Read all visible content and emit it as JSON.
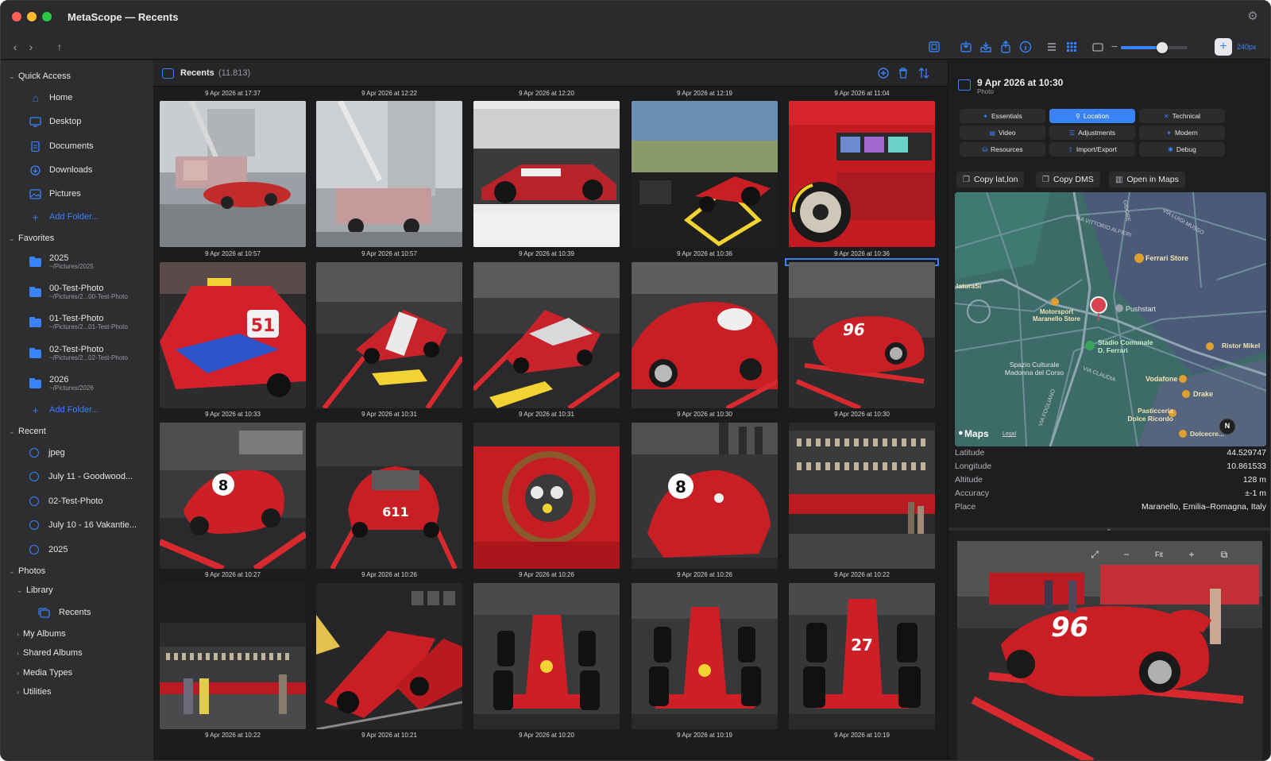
{
  "window": {
    "title": "MetaScope — Recents"
  },
  "toolbar": {
    "back": "‹",
    "forward": "›",
    "up": "↑",
    "minus": "−",
    "plus": "+",
    "thumb_size": "240px",
    "thumb_size_fraction": 0.62,
    "accent": "#3a82f7"
  },
  "sidebar": {
    "quick_access": {
      "label": "Quick Access",
      "items": [
        {
          "label": "Home",
          "icon": "house-icon"
        },
        {
          "label": "Desktop",
          "icon": "desktop-icon"
        },
        {
          "label": "Documents",
          "icon": "document-icon"
        },
        {
          "label": "Downloads",
          "icon": "download-icon"
        },
        {
          "label": "Pictures",
          "icon": "photo-icon"
        }
      ],
      "add": "Add Folder..."
    },
    "favorites": {
      "label": "Favorites",
      "items": [
        {
          "name": "2025",
          "path": "~/Pictures/2025"
        },
        {
          "name": "00-Test-Photo",
          "path": "~/Pictures/2...00-Test-Photo"
        },
        {
          "name": "01-Test-Photo",
          "path": "~/Pictures/2...01-Test-Photo"
        },
        {
          "name": "02-Test-Photo",
          "path": "~/Pictures/2...02-Test-Photo"
        },
        {
          "name": "2026",
          "path": "~/Pictures/2026"
        }
      ],
      "add": "Add Folder..."
    },
    "recent": {
      "label": "Recent",
      "items": [
        "jpeg",
        "July 11 - Goodwood...",
        "02-Test-Photo",
        "July 10 - 16 Vakantie...",
        "2025"
      ]
    },
    "photos": {
      "label": "Photos",
      "library": "Library",
      "recents": "Recents",
      "groups": [
        "My Albums",
        "Shared Albums",
        "Media Types",
        "Utilities"
      ]
    }
  },
  "grid": {
    "title": "Recents",
    "count": "(11.813)",
    "top_captions": [
      "9 Apr 2026 at 17:37",
      "9 Apr 2026 at 12:22",
      "9 Apr 2026 at 12:20",
      "9 Apr 2026 at 12:19",
      "9 Apr 2026 at 11:04"
    ],
    "rows": [
      [
        "9 Apr 2026 at 10:57",
        "9 Apr 2026 at 10:57",
        "9 Apr 2026 at 10:39",
        "9 Apr 2026 at 10:36",
        "9 Apr 2026 at 10:36"
      ],
      [
        "9 Apr 2026 at 10:33",
        "9 Apr 2026 at 10:31",
        "9 Apr 2026 at 10:31",
        "9 Apr 2026 at 10:30",
        "9 Apr 2026 at 10:30"
      ],
      [
        "9 Apr 2026 at 10:27",
        "9 Apr 2026 at 10:26",
        "9 Apr 2026 at 10:26",
        "9 Apr 2026 at 10:26",
        "9 Apr 2026 at 10:22"
      ],
      [
        "9 Apr 2026 at 10:22",
        "9 Apr 2026 at 10:21",
        "9 Apr 2026 at 10:20",
        "9 Apr 2026 at 10:19",
        "9 Apr 2026 at 10:19"
      ]
    ],
    "selected": "r1c4"
  },
  "inspector": {
    "title": "9 Apr 2026 at 10:30",
    "subtitle": "Photo",
    "tabs": [
      {
        "label": "Essentials",
        "icon": "sparkle-icon"
      },
      {
        "label": "Location",
        "icon": "pin-icon",
        "active": true
      },
      {
        "label": "Technical",
        "icon": "tools-icon"
      },
      {
        "label": "Video",
        "icon": "film-icon"
      },
      {
        "label": "Adjustments",
        "icon": "sliders-icon"
      },
      {
        "label": "Modern",
        "icon": "sparkle-icon"
      },
      {
        "label": "Resources",
        "icon": "disk-icon"
      },
      {
        "label": "Import/Export",
        "icon": "export-icon"
      },
      {
        "label": "Debug",
        "icon": "bug-icon"
      }
    ],
    "actions": [
      {
        "label": "Copy lat,lon",
        "icon": "copy-icon"
      },
      {
        "label": "Copy DMS",
        "icon": "copy-icon"
      },
      {
        "label": "Open in Maps",
        "icon": "map-icon"
      }
    ],
    "map": {
      "brand": "Maps",
      "legal": "Legal",
      "north": "N",
      "labels": {
        "ferrari_store": "Ferrari Store",
        "maranello_store": "Motorsport Maranello Store",
        "pushstart": "Pushstart",
        "stadio": "Stadio Comunale D. Ferrari",
        "spazio": "Spazio Culturale Madonna del Corso",
        "vodafone": "Vodafone",
        "drake": "Drake",
        "pasticceria": "Pasticceria Dolce Ricordo",
        "ristor": "Ristor Mikel",
        "dolce": "Dolcecre...",
        "laturasi": "laturaSi",
        "via_vittorio": "VIA VITTORIO ALFIERI",
        "via_claudia": "VIA CLAUDIA",
        "via_musso": "VIA LUIGI MUSSO",
        "via_fogliano": "VIA FOGLIANO",
        "gidore": "GIDORE"
      }
    },
    "fields": [
      {
        "key": "Latitude",
        "value": "44.529747"
      },
      {
        "key": "Longitude",
        "value": "10.861533"
      },
      {
        "key": "Altitude",
        "value": "128 m"
      },
      {
        "key": "Accuracy",
        "value": "±-1 m"
      },
      {
        "key": "Place",
        "value": "Maranello, Emilia–Romagna, Italy"
      }
    ],
    "preview": {
      "fit": "Fit",
      "minus": "−",
      "plus": "+"
    }
  }
}
